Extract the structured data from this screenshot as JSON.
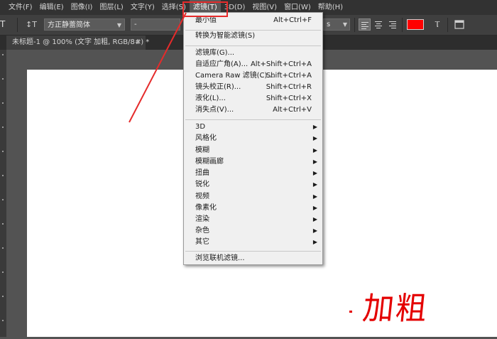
{
  "menubar": {
    "items": [
      "文件(F)",
      "编辑(E)",
      "图像(I)",
      "图层(L)",
      "文字(Y)",
      "选择(S)",
      "滤镜(T)",
      "3D(D)",
      "视图(V)",
      "窗口(W)",
      "帮助(H)"
    ],
    "active_index": 6
  },
  "options": {
    "font_family": "方正静蕾简体",
    "font_style": "-",
    "antialias": "s",
    "color": "#ff0000"
  },
  "tab": {
    "title": "未标题-1 @ 100% (文字 加粗, RGB/8#) *",
    "close": "×"
  },
  "filter_menu": {
    "groups": [
      [
        {
          "label": "最小值",
          "shortcut": "Alt+Ctrl+F"
        }
      ],
      [
        {
          "label": "转换为智能滤镜(S)",
          "shortcut": ""
        }
      ],
      [
        {
          "label": "滤镜库(G)...",
          "shortcut": ""
        },
        {
          "label": "自适应广角(A)...",
          "shortcut": "Alt+Shift+Ctrl+A"
        },
        {
          "label": "Camera Raw 滤镜(C)...",
          "shortcut": "Shift+Ctrl+A"
        },
        {
          "label": "镜头校正(R)...",
          "shortcut": "Shift+Ctrl+R"
        },
        {
          "label": "液化(L)...",
          "shortcut": "Shift+Ctrl+X"
        },
        {
          "label": "消失点(V)...",
          "shortcut": "Alt+Ctrl+V"
        }
      ],
      [
        {
          "label": "3D",
          "submenu": true
        },
        {
          "label": "风格化",
          "submenu": true
        },
        {
          "label": "模糊",
          "submenu": true
        },
        {
          "label": "模糊画廊",
          "submenu": true
        },
        {
          "label": "扭曲",
          "submenu": true
        },
        {
          "label": "锐化",
          "submenu": true
        },
        {
          "label": "视频",
          "submenu": true
        },
        {
          "label": "像素化",
          "submenu": true
        },
        {
          "label": "渲染",
          "submenu": true
        },
        {
          "label": "杂色",
          "submenu": true
        },
        {
          "label": "其它",
          "submenu": true
        }
      ],
      [
        {
          "label": "浏览联机滤镜...",
          "shortcut": ""
        }
      ]
    ]
  },
  "canvas": {
    "text": "加粗",
    "text_color": "#e40000"
  },
  "annotation": {
    "color": "#e52b2b"
  }
}
